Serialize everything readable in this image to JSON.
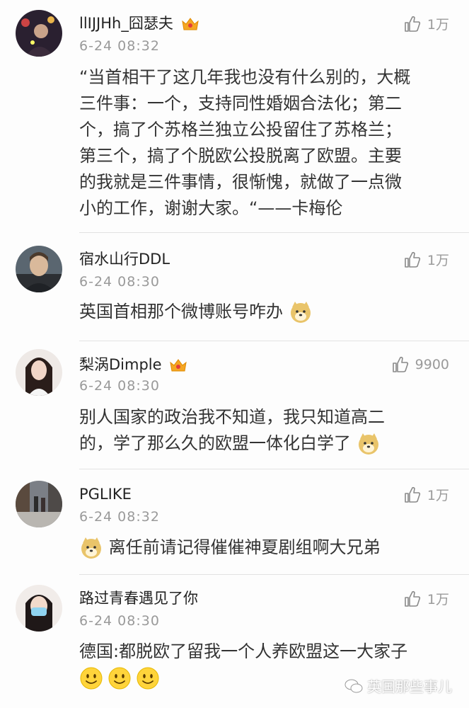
{
  "comments": [
    {
      "username": "llIJJHh_囧瑟夫",
      "time": "6-24 08:32",
      "likes": "1万",
      "text_lines": [
        "“当首相干了这几年我也没有什么别的，大概",
        "三件事：一个，支持同性婚姻合法化；第二",
        "个，搞了个苏格兰独立公投留住了苏格兰；",
        "第三个，搞了个脱欧公投脱离了欧盟。主要",
        "的我就是三件事情，很惭愧，就做了一点微",
        "小的工作，谢谢大家。“——卡梅伦"
      ],
      "crown": true
    },
    {
      "username": "宿水山行DDL",
      "time": "6-24 08:30",
      "likes": "1万",
      "text": "英国首相那个微博账号咋办"
    },
    {
      "username": "梨涡Dimple",
      "time": "6-24 08:30",
      "likes": "9900",
      "text_lines": [
        "别人国家的政治我不知道，我只知道高二",
        "的，学了那么久的欧盟一体化白学了"
      ],
      "crown": true
    },
    {
      "username": "PGLIKE",
      "time": "6-24 08:32",
      "likes": "1万",
      "text": "离任前请记得催催神夏剧组啊大兄弟"
    },
    {
      "username": "路过青春遇见了你",
      "time": "6-24 08:30",
      "likes": "1万",
      "text": "德国:都脱欧了留我一个人养欧盟这一大家子"
    }
  ],
  "watermark": "英国那些事儿",
  "icons": {
    "like": "thumbs-up-icon",
    "crown": "crown-icon",
    "doge": "doge-emoji",
    "smile": "smile-emoji"
  },
  "colors": {
    "text": "#333333",
    "meta": "#9a9a9a",
    "crown": "#f5a623"
  }
}
